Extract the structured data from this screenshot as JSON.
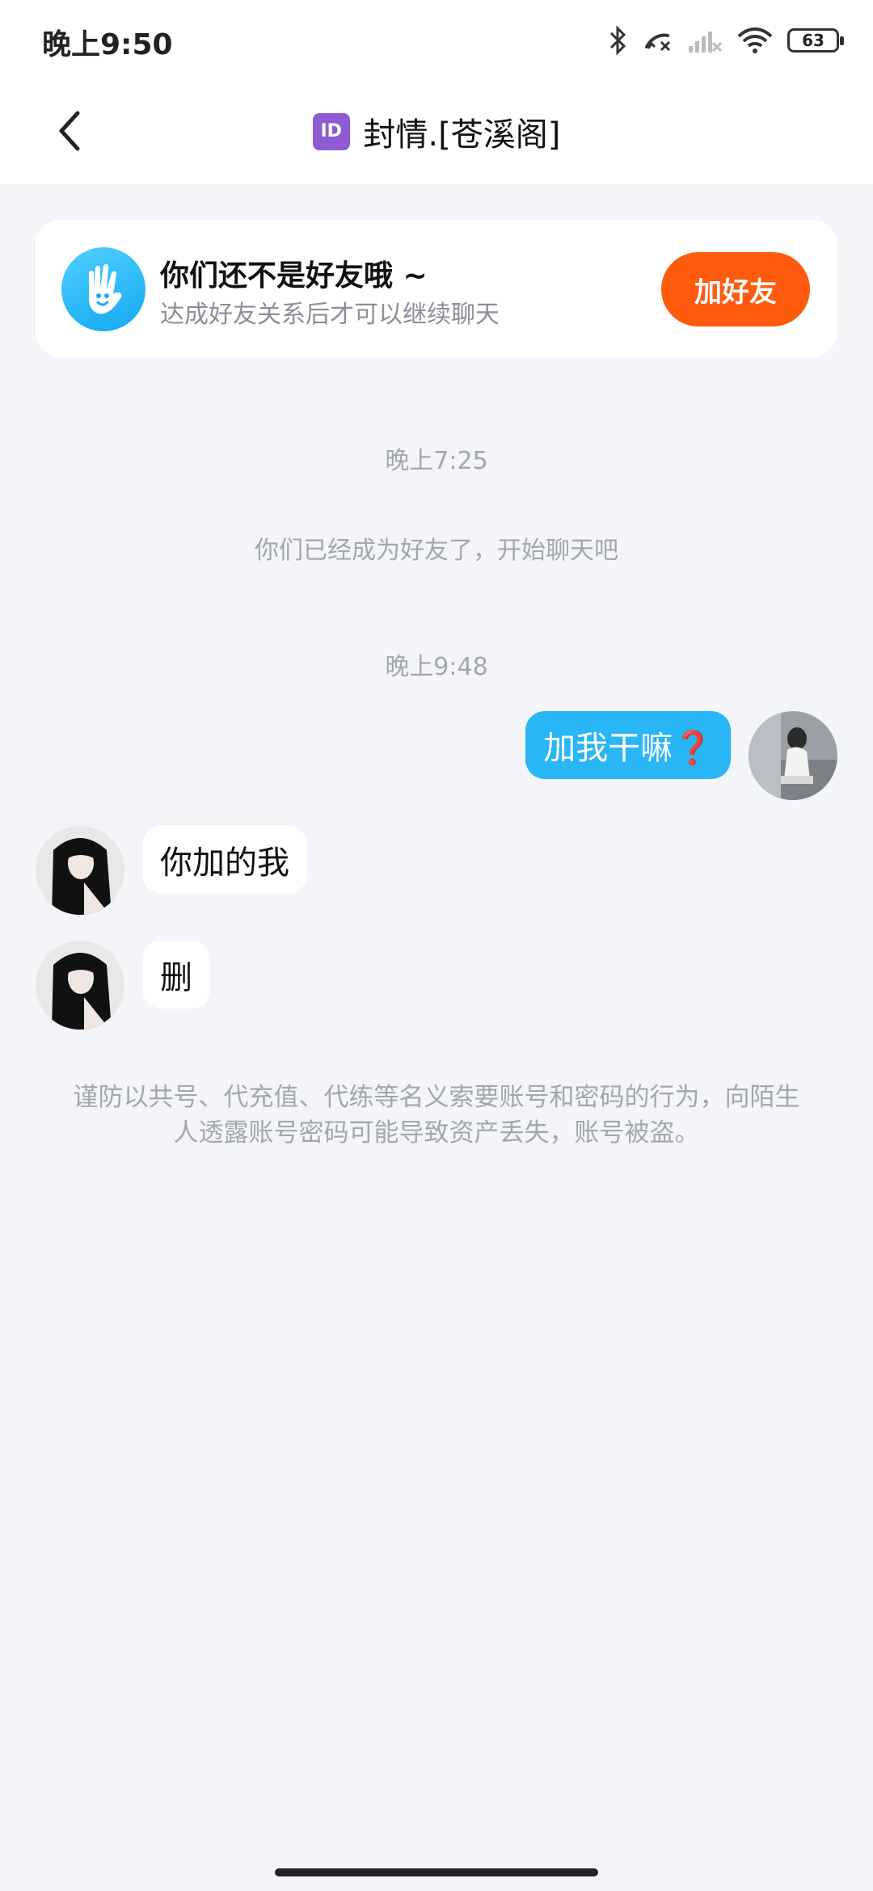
{
  "status_bar": {
    "time": "晚上9:50",
    "battery": "63",
    "icons": [
      "bluetooth-icon",
      "call-missed-icon",
      "signal-icon",
      "wifi-icon",
      "battery-icon"
    ]
  },
  "header": {
    "id_badge": "ID",
    "title": "封情.[苍溪阁]",
    "back_icon": "chevron-left-icon"
  },
  "friend_banner": {
    "title": "你们还不是好友哦 ~",
    "subtitle": "达成好友关系后才可以继续聊天",
    "button_label": "加好友",
    "accent": "#ff5b0f"
  },
  "messages": {
    "time_1": "晚上7:25",
    "system_1": "你们已经成为好友了，开始聊天吧",
    "time_2": "晚上9:48",
    "outgoing_1": "加我干嘛❓",
    "incoming_1": "你加的我",
    "incoming_2": "删"
  },
  "warning": "谨防以共号、代充值、代练等名义索要账号和密码的行为，向陌生人透露账号密码可能导致资产丢失，账号被盗。",
  "colors": {
    "outgoing_bubble": "#29b6f6",
    "background": "#f3f5f8"
  }
}
